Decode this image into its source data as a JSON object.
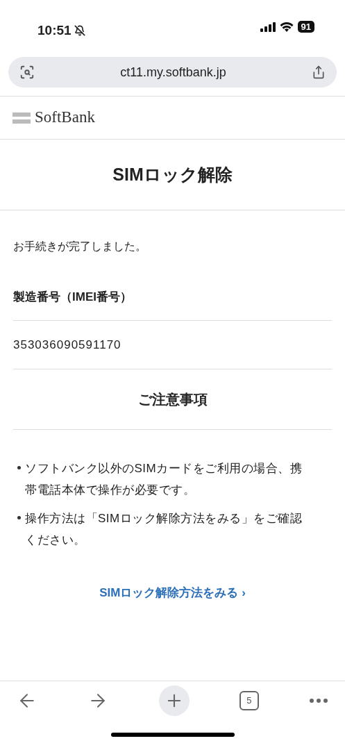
{
  "status_bar": {
    "time": "10:51",
    "battery": "91"
  },
  "browser": {
    "url": "ct11.my.softbank.jp",
    "tab_count": "5"
  },
  "site": {
    "logo": "SoftBank"
  },
  "page": {
    "title": "SIMロック解除",
    "message": "お手続きが完了しました。",
    "field_label": "製造番号（IMEI番号）",
    "field_value": "353036090591170",
    "notes_title": "ご注意事項",
    "notes": [
      "ソフトバンク以外のSIMカードをご利用の場合、携帯電話本体で操作が必要です。",
      "操作方法は「SIMロック解除方法をみる」をご確認ください。"
    ],
    "link": "SIMロック解除方法をみる",
    "link_arrow": "›"
  }
}
